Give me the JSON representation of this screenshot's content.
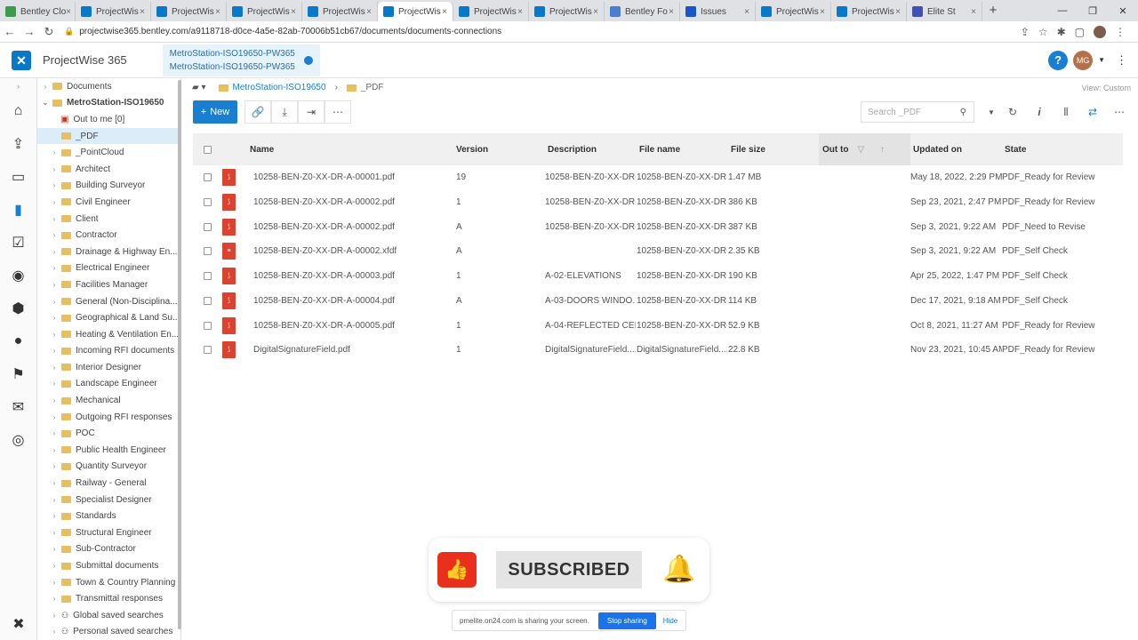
{
  "browser": {
    "tabs": [
      "Bentley Clo",
      "ProjectWis",
      "ProjectWis",
      "ProjectWis",
      "ProjectWis",
      "ProjectWis",
      "ProjectWis",
      "ProjectWis",
      "Bentley Fo",
      "Issues",
      "ProjectWis",
      "ProjectWis",
      "Elite St"
    ],
    "active_tab": 5,
    "url": "projectwise365.bentley.com/a9118718-d0ce-4a5e-82ab-70006b51cb67/documents/documents-connections"
  },
  "app": {
    "name": "ProjectWise 365",
    "context_line1": "MetroStation-ISO19650-PW365",
    "context_line2": "MetroStation-ISO19650-PW365",
    "user_initials": "MG",
    "help_label": "?"
  },
  "tree": {
    "documents": "Documents",
    "project": "MetroStation-ISO19650",
    "out_to_me": "Out to me [0]",
    "selected": "_PDF",
    "folders": [
      "_PointCloud",
      "Architect",
      "Building Surveyor",
      "Civil Engineer",
      "Client",
      "Contractor",
      "Drainage & Highway En...",
      "Electrical Engineer",
      "Facilities Manager",
      "General (Non-Disciplina...",
      "Geographical & Land Su...",
      "Heating & Ventilation En...",
      "Incoming RFI documents",
      "Interior Designer",
      "Landscape Engineer",
      "Mechanical",
      "Outgoing RFI responses",
      "POC",
      "Public Health Engineer",
      "Quantity Surveyor",
      "Railway - General",
      "Specialist Designer",
      "Standards",
      "Structural Engineer",
      "Sub-Contractor",
      "Submittal documents",
      "Town & Country Planning",
      "Transmittal responses"
    ],
    "global_searches": "Global saved searches",
    "personal_searches": "Personal saved searches"
  },
  "breadcrumb": {
    "project": "MetroStation-ISO19650",
    "folder": "_PDF"
  },
  "view_custom": "View: Custom",
  "toolbar": {
    "new_label": "New",
    "search_placeholder": "Search _PDF"
  },
  "table": {
    "headers": {
      "name": "Name",
      "version": "Version",
      "description": "Description",
      "file_name": "File name",
      "file_size": "File size",
      "out_to": "Out to",
      "updated": "Updated on",
      "state": "State"
    },
    "rows": [
      {
        "name": "10258-BEN-Z0-XX-DR-A-00001.pdf",
        "version": "19",
        "description": "10258-BEN-Z0-XX-DR-...",
        "file_name": "10258-BEN-Z0-XX-DR-...",
        "size": "1.47 MB",
        "updated": "May 18, 2022, 2:29 PM",
        "state": "PDF_Ready for Review"
      },
      {
        "name": "10258-BEN-Z0-XX-DR-A-00002.pdf",
        "version": "1",
        "description": "10258-BEN-Z0-XX-DR-...",
        "file_name": "10258-BEN-Z0-XX-DR-...",
        "size": "386 KB",
        "updated": "Sep 23, 2021, 2:47 PM",
        "state": "PDF_Ready for Review"
      },
      {
        "name": "10258-BEN-Z0-XX-DR-A-00002.pdf",
        "version": "A",
        "description": "10258-BEN-Z0-XX-DR-...",
        "file_name": "10258-BEN-Z0-XX-DR-...",
        "size": "387 KB",
        "updated": "Sep 3, 2021, 9:22 AM",
        "state": "PDF_Need to Revise"
      },
      {
        "name": "10258-BEN-Z0-XX-DR-A-00002.xfdf",
        "version": "A",
        "description": "",
        "file_name": "10258-BEN-Z0-XX-DR-...",
        "size": "2.35 KB",
        "updated": "Sep 3, 2021, 9:22 AM",
        "state": "PDF_Self Check"
      },
      {
        "name": "10258-BEN-Z0-XX-DR-A-00003.pdf",
        "version": "1",
        "description": "A-02-ELEVATIONS",
        "file_name": "10258-BEN-Z0-XX-DR-...",
        "size": "190 KB",
        "updated": "Apr 25, 2022, 1:47 PM",
        "state": "PDF_Self Check"
      },
      {
        "name": "10258-BEN-Z0-XX-DR-A-00004.pdf",
        "version": "A",
        "description": "A-03-DOORS WINDO...",
        "file_name": "10258-BEN-Z0-XX-DR-...",
        "size": "114 KB",
        "updated": "Dec 17, 2021, 9:18 AM",
        "state": "PDF_Self Check"
      },
      {
        "name": "10258-BEN-Z0-XX-DR-A-00005.pdf",
        "version": "1",
        "description": "A-04-REFLECTED CEILI...",
        "file_name": "10258-BEN-Z0-XX-DR-...",
        "size": "52.9 KB",
        "updated": "Oct 8, 2021, 11:27 AM",
        "state": "PDF_Ready for Review"
      },
      {
        "name": "DigitalSignatureField.pdf",
        "version": "1",
        "description": "DigitalSignatureField....",
        "file_name": "DigitalSignatureField....",
        "size": "22.8 KB",
        "updated": "Nov 23, 2021, 10:45 AM",
        "state": "PDF_Ready for Review"
      }
    ]
  },
  "overlay": {
    "subscribed": "SUBSCRIBED",
    "share_text": "pmelite.on24.com is sharing your screen.",
    "stop_label": "Stop sharing",
    "hide_label": "Hide"
  }
}
